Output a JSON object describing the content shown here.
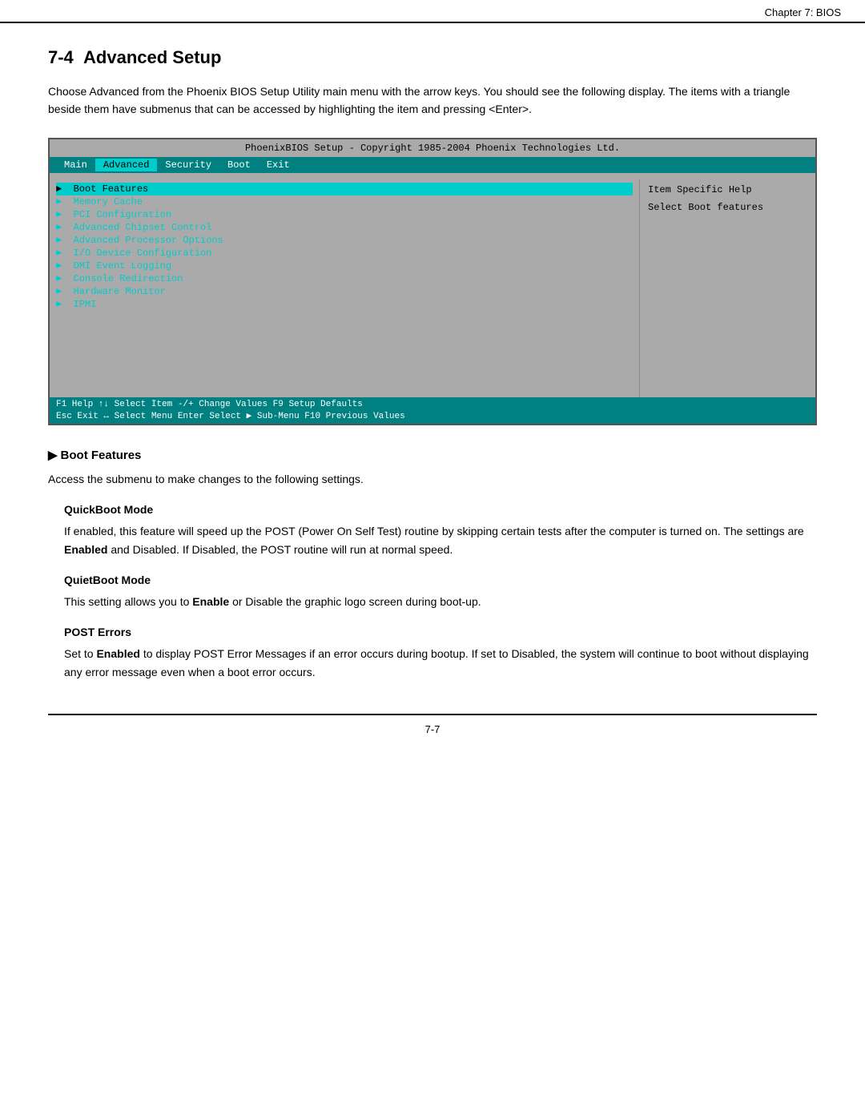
{
  "chapter_label": "Chapter 7: BIOS",
  "section": {
    "number": "7-4",
    "title": "Advanced Setup",
    "intro": "Choose Advanced from the  Phoenix BIOS Setup Utility main menu with the arrow keys.  You should see the following display.  The items with a triangle beside them have submenus that can be accessed by highlighting the item and pressing <Enter>."
  },
  "bios_screen": {
    "title_bar": "PhoenixBIOS Setup - Copyright 1985-2004 Phoenix Technologies Ltd.",
    "menu_items": [
      {
        "label": "Main",
        "active": false
      },
      {
        "label": "Advanced",
        "active": true
      },
      {
        "label": "Security",
        "active": false
      },
      {
        "label": "Boot",
        "active": false
      },
      {
        "label": "Exit",
        "active": false
      }
    ],
    "menu_entries": [
      "▶  Boot Features",
      "▶  Memory Cache",
      "▶  PCI Configuration",
      "▶  Advanced Chipset Control",
      "▶  Advanced Processor Options",
      "▶  I/O Device Configuration",
      "▶  DMI Event Logging",
      "▶  Console Redirection",
      "▶  Hardware Monitor",
      "▶  IPMI"
    ],
    "help_title": "Item Specific Help",
    "help_text": "Select Boot features",
    "footer_row1": "F1  Help  ↑↓ Select Item   -/+   Change Values    F9  Setup Defaults",
    "footer_row2": "Esc Exit  ↔ Select Menu   Enter Select ▶ Sub-Menu  F10 Previous Values"
  },
  "boot_features": {
    "heading": "Boot Features",
    "intro": "Access the submenu to make changes to the following settings.",
    "quickboot": {
      "heading": "QuickBoot Mode",
      "text_before": "If enabled, this feature will speed up the POST (Power On Self Test) routine by skipping certain tests after the computer is turned on. The settings are ",
      "bold": "Enabled",
      "text_after": " and Disabled. If Disabled, the POST routine will run at normal speed."
    },
    "quietboot": {
      "heading": "QuietBoot Mode",
      "text_before": "This setting allows you to ",
      "bold": "Enable",
      "text_after": " or Disable the graphic logo screen during boot-up."
    },
    "post_errors": {
      "heading": "POST Errors",
      "text_before": "Set to ",
      "bold": "Enabled",
      "text_after": " to display POST Error Messages if an error occurs during bootup. If set to Disabled, the system will continue to boot without displaying any error message even when a boot error occurs."
    }
  },
  "footer": {
    "page_number": "7-7"
  }
}
